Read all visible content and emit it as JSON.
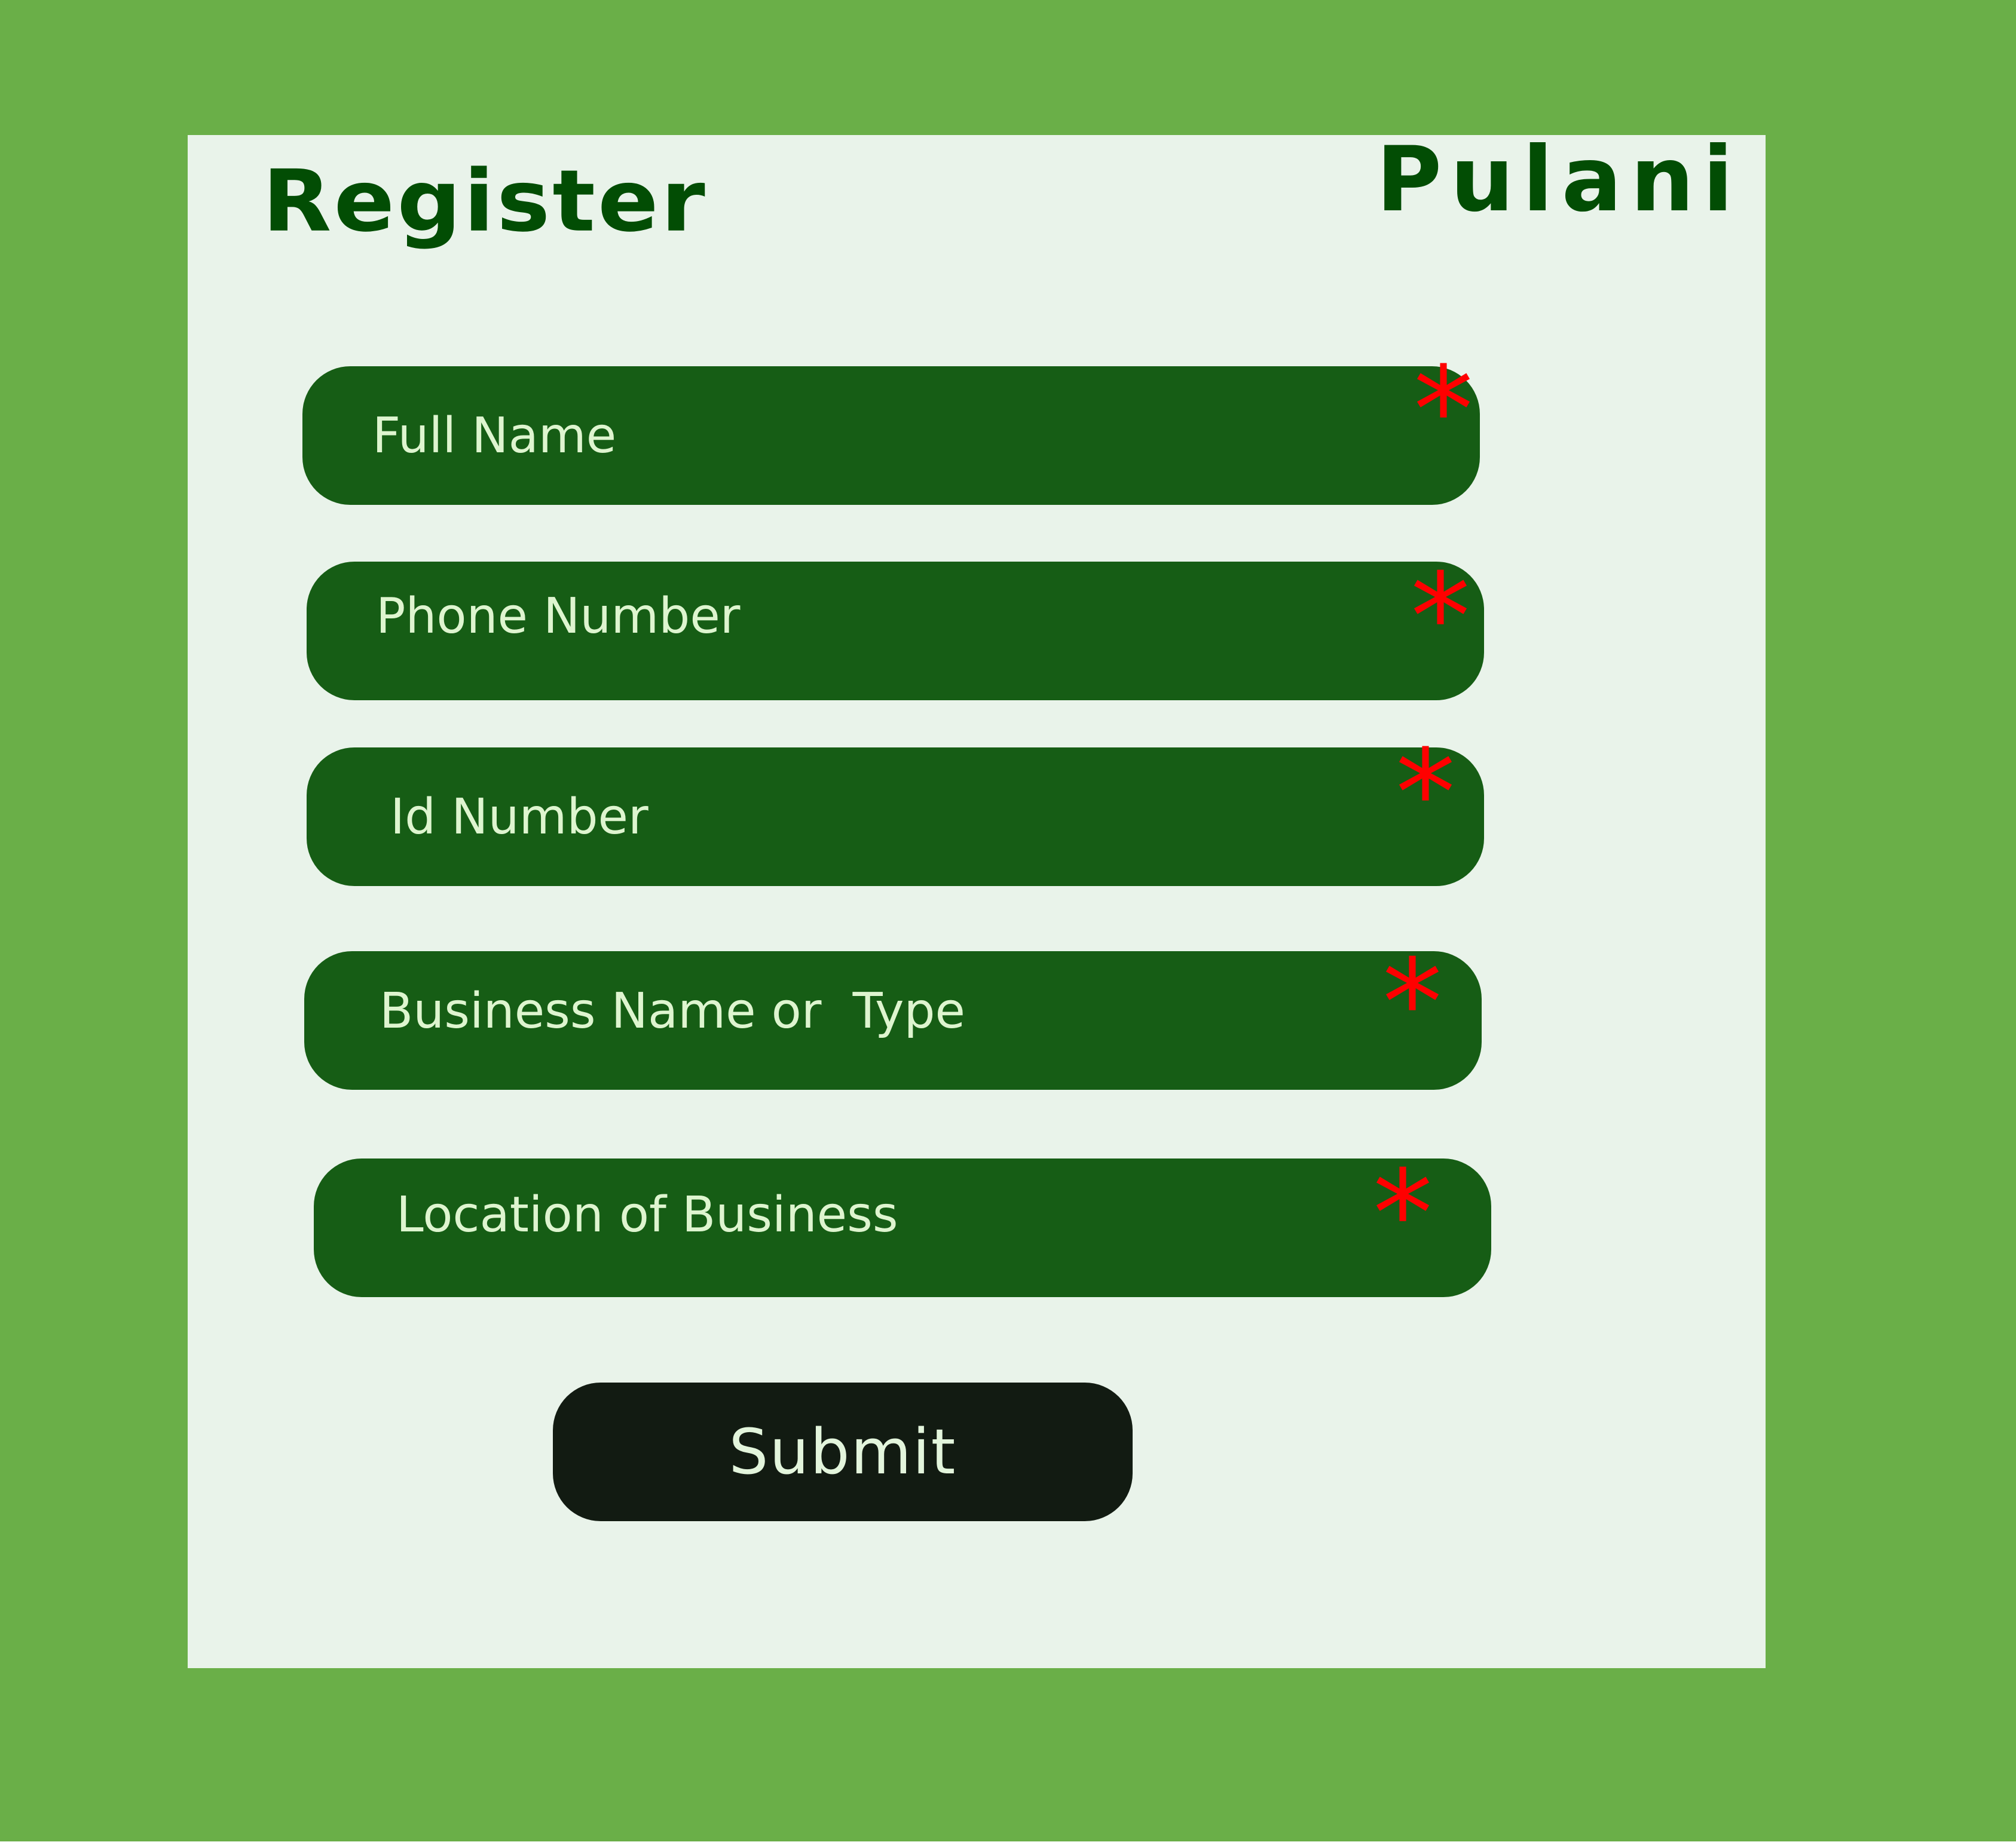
{
  "page": {
    "title": "Register",
    "brand": "Pulani"
  },
  "form": {
    "fields": [
      {
        "label": "Full Name",
        "required_mark": "*"
      },
      {
        "label": "Phone Number",
        "required_mark": "*"
      },
      {
        "label": "Id Number",
        "required_mark": "*"
      },
      {
        "label": "Business Name or  Type",
        "required_mark": "*"
      },
      {
        "label": "Location of Business",
        "required_mark": "*"
      }
    ],
    "submit_label": "Submit"
  },
  "colors": {
    "background": "#6aaf48",
    "card": "#e9f3ea",
    "heading": "#024d04",
    "field": "#165d15",
    "field_text": "#def5cf",
    "required": "#ff0000",
    "submit": "#121b12"
  }
}
